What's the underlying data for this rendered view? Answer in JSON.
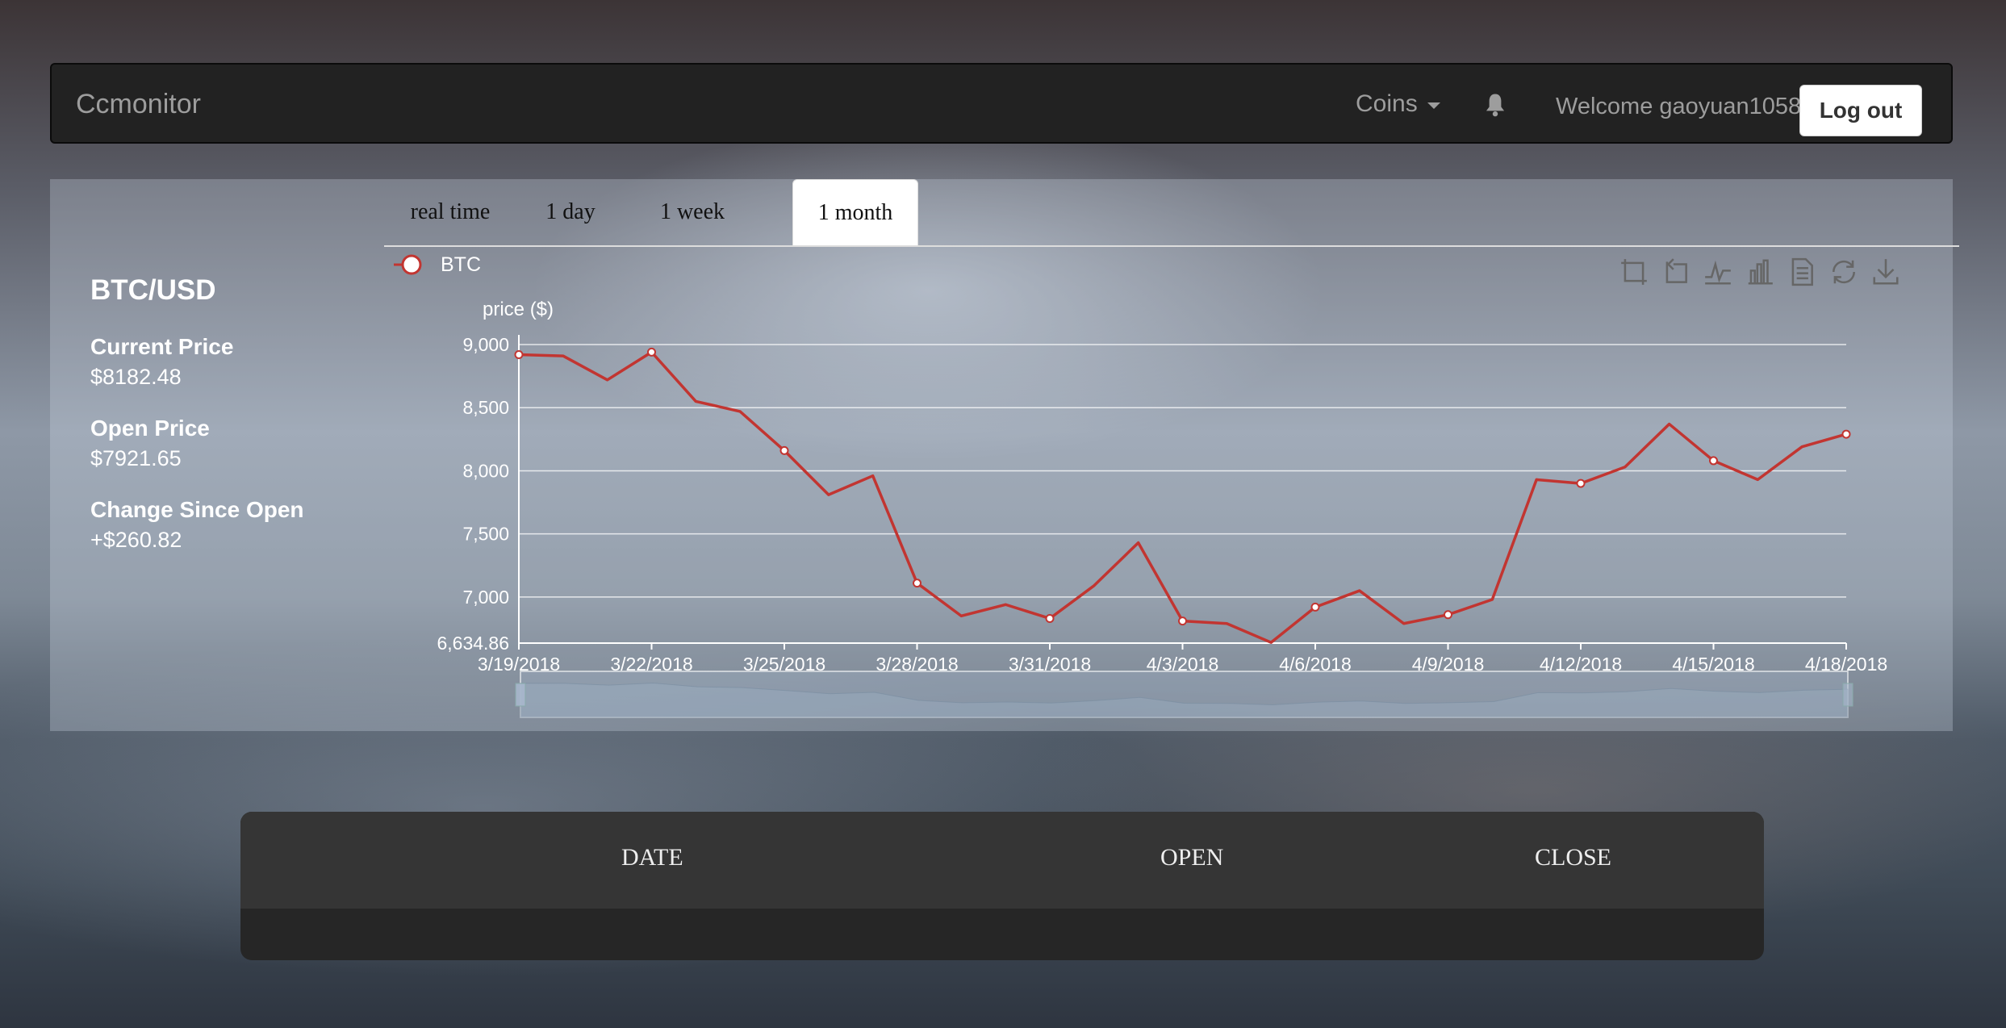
{
  "navbar": {
    "brand": "Ccmonitor",
    "coins_label": "Coins",
    "welcome": "Welcome gaoyuan1058",
    "logout": "Log out"
  },
  "info": {
    "pair": "BTC/USD",
    "current_price_label": "Current Price",
    "current_price": "$8182.48",
    "open_price_label": "Open Price",
    "open_price": "$7921.65",
    "change_label": "Change Since Open",
    "change": "+$260.82"
  },
  "tabs": [
    "real time",
    "1 day",
    "1 week",
    "1 month"
  ],
  "active_tab": "1 month",
  "table": {
    "headers": [
      "DATE",
      "OPEN",
      "CLOSE"
    ]
  },
  "colors": {
    "line": "#c23531",
    "navbar": "#222222",
    "table_header": "#353535"
  },
  "chart_data": {
    "type": "line",
    "legend": [
      "BTC"
    ],
    "ylabel": "price ($)",
    "ylim": [
      6634.86,
      9000
    ],
    "y_ticks": [
      "6,634.86",
      "7,000",
      "7,500",
      "8,000",
      "8,500",
      "9,000"
    ],
    "x_tick_labels": [
      "3/19/2018",
      "3/22/2018",
      "3/25/2018",
      "3/28/2018",
      "3/31/2018",
      "4/3/2018",
      "4/6/2018",
      "4/9/2018",
      "4/12/2018",
      "4/15/2018",
      "4/18/2018"
    ],
    "x": [
      "3/19/2018",
      "3/20/2018",
      "3/21/2018",
      "3/22/2018",
      "3/23/2018",
      "3/24/2018",
      "3/25/2018",
      "3/26/2018",
      "3/27/2018",
      "3/28/2018",
      "3/29/2018",
      "3/30/2018",
      "3/31/2018",
      "4/1/2018",
      "4/2/2018",
      "4/3/2018",
      "4/4/2018",
      "4/5/2018",
      "4/6/2018",
      "4/7/2018",
      "4/8/2018",
      "4/9/2018",
      "4/10/2018",
      "4/11/2018",
      "4/12/2018",
      "4/13/2018",
      "4/14/2018",
      "4/15/2018",
      "4/16/2018",
      "4/17/2018",
      "4/18/2018"
    ],
    "series": [
      {
        "name": "BTC",
        "values": [
          8920,
          8910,
          8720,
          8940,
          8550,
          8470,
          8160,
          7810,
          7960,
          7110,
          6850,
          6940,
          6830,
          7090,
          7430,
          6810,
          6790,
          6640,
          6920,
          7050,
          6790,
          6860,
          6980,
          7930,
          7900,
          8030,
          8370,
          8080,
          7930,
          8190,
          8290
        ]
      }
    ],
    "tool_icons": [
      "zoom-icon",
      "zoom-reset-icon",
      "line-chart-icon",
      "bar-chart-icon",
      "data-view-icon",
      "restore-icon",
      "save-image-icon"
    ]
  }
}
